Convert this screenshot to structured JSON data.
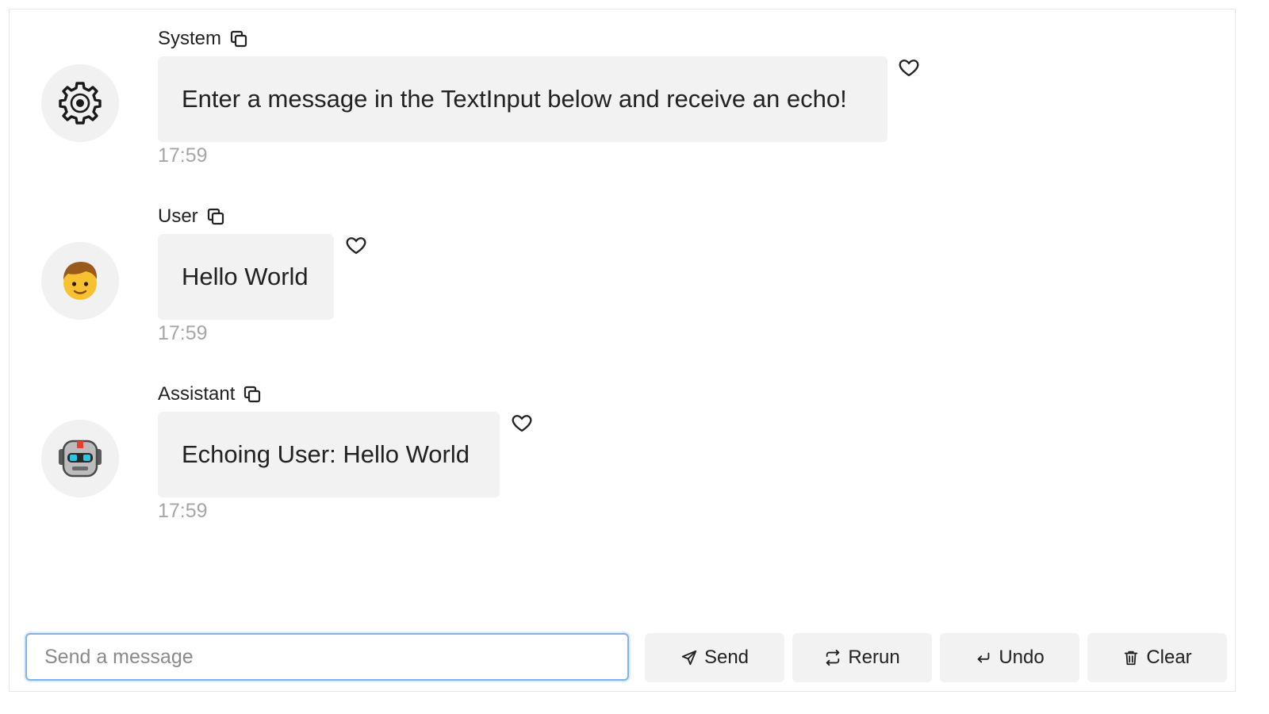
{
  "messages": [
    {
      "role": "system",
      "name": "System",
      "text": "Enter a message in the TextInput below and receive an echo!",
      "time": "17:59",
      "avatar_icon": "gear-icon"
    },
    {
      "role": "user",
      "name": "User",
      "text": "Hello World",
      "time": "17:59",
      "avatar_icon": "boy-emoji-icon"
    },
    {
      "role": "assistant",
      "name": "Assistant",
      "text": "Echoing User: Hello World",
      "time": "17:59",
      "avatar_icon": "robot-emoji-icon"
    }
  ],
  "input": {
    "placeholder": "Send a message",
    "value": ""
  },
  "buttons": {
    "send": {
      "label": "Send",
      "icon": "send-icon"
    },
    "rerun": {
      "label": "Rerun",
      "icon": "rerun-icon"
    },
    "undo": {
      "label": "Undo",
      "icon": "undo-icon"
    },
    "clear": {
      "label": "Clear",
      "icon": "trash-icon"
    }
  },
  "colors": {
    "input_focus_border": "#7fb3ea",
    "bubble_bg": "#f2f2f2",
    "timestamp": "#a6a6a6"
  }
}
